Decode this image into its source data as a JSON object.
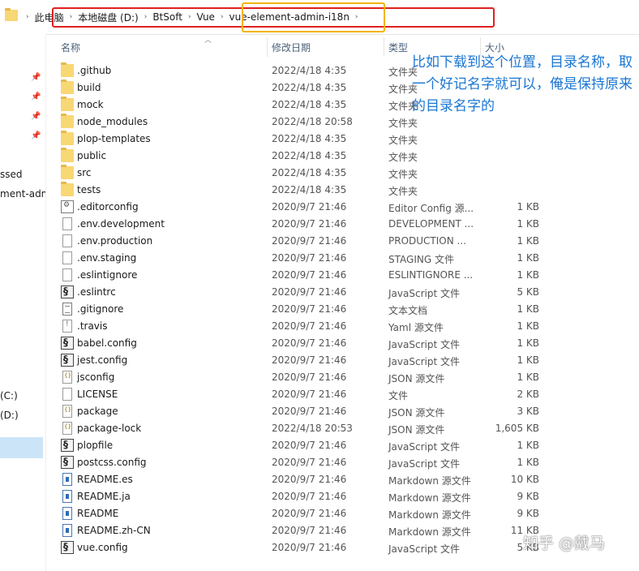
{
  "breadcrumbs": [
    "此电脑",
    "本地磁盘 (D:)",
    "BtSoft",
    "Vue",
    "vue-element-admin-i18n"
  ],
  "columns": {
    "name": "名称",
    "date": "修改日期",
    "type": "类型",
    "size": "大小"
  },
  "nav": {
    "items": [
      "ssed",
      "ment-adm",
      "(C:)",
      "(D:)"
    ]
  },
  "annotation": "比如下载到这个位置，目录名称，取一个好记名字就可以，俺是保持原来的目录名字的",
  "watermark": "知乎 @戴马",
  "files": [
    {
      "name": ".github",
      "date": "2022/4/18 4:35",
      "type": "文件夹",
      "size": "",
      "icon": "folder-icon"
    },
    {
      "name": "build",
      "date": "2022/4/18 4:35",
      "type": "文件夹",
      "size": "",
      "icon": "folder-icon"
    },
    {
      "name": "mock",
      "date": "2022/4/18 4:35",
      "type": "文件夹",
      "size": "",
      "icon": "folder-icon"
    },
    {
      "name": "node_modules",
      "date": "2022/4/18 20:58",
      "type": "文件夹",
      "size": "",
      "icon": "folder-icon"
    },
    {
      "name": "plop-templates",
      "date": "2022/4/18 4:35",
      "type": "文件夹",
      "size": "",
      "icon": "folder-icon"
    },
    {
      "name": "public",
      "date": "2022/4/18 4:35",
      "type": "文件夹",
      "size": "",
      "icon": "folder-icon"
    },
    {
      "name": "src",
      "date": "2022/4/18 4:35",
      "type": "文件夹",
      "size": "",
      "icon": "folder-icon"
    },
    {
      "name": "tests",
      "date": "2022/4/18 4:35",
      "type": "文件夹",
      "size": "",
      "icon": "folder-icon"
    },
    {
      "name": ".editorconfig",
      "date": "2020/9/7 21:46",
      "type": "Editor Config 源...",
      "size": "1 KB",
      "icon": "config-file-icon"
    },
    {
      "name": ".env.development",
      "date": "2020/9/7 21:46",
      "type": "DEVELOPMENT ...",
      "size": "1 KB",
      "icon": "file-icon"
    },
    {
      "name": ".env.production",
      "date": "2020/9/7 21:46",
      "type": "PRODUCTION ...",
      "size": "1 KB",
      "icon": "file-icon"
    },
    {
      "name": ".env.staging",
      "date": "2020/9/7 21:46",
      "type": "STAGING 文件",
      "size": "1 KB",
      "icon": "file-icon"
    },
    {
      "name": ".eslintignore",
      "date": "2020/9/7 21:46",
      "type": "ESLINTIGNORE ...",
      "size": "1 KB",
      "icon": "file-icon"
    },
    {
      "name": ".eslintrc",
      "date": "2020/9/7 21:46",
      "type": "JavaScript 文件",
      "size": "5 KB",
      "icon": "js-file-icon"
    },
    {
      "name": ".gitignore",
      "date": "2020/9/7 21:46",
      "type": "文本文档",
      "size": "1 KB",
      "icon": "text-file-icon"
    },
    {
      "name": ".travis",
      "date": "2020/9/7 21:46",
      "type": "Yaml 源文件",
      "size": "1 KB",
      "icon": "yaml-file-icon"
    },
    {
      "name": "babel.config",
      "date": "2020/9/7 21:46",
      "type": "JavaScript 文件",
      "size": "1 KB",
      "icon": "js-file-icon"
    },
    {
      "name": "jest.config",
      "date": "2020/9/7 21:46",
      "type": "JavaScript 文件",
      "size": "1 KB",
      "icon": "js-file-icon"
    },
    {
      "name": "jsconfig",
      "date": "2020/9/7 21:46",
      "type": "JSON 源文件",
      "size": "1 KB",
      "icon": "json-file-icon"
    },
    {
      "name": "LICENSE",
      "date": "2020/9/7 21:46",
      "type": "文件",
      "size": "2 KB",
      "icon": "file-icon"
    },
    {
      "name": "package",
      "date": "2020/9/7 21:46",
      "type": "JSON 源文件",
      "size": "3 KB",
      "icon": "json-file-icon"
    },
    {
      "name": "package-lock",
      "date": "2022/4/18 20:53",
      "type": "JSON 源文件",
      "size": "1,605 KB",
      "icon": "json-file-icon"
    },
    {
      "name": "plopfile",
      "date": "2020/9/7 21:46",
      "type": "JavaScript 文件",
      "size": "1 KB",
      "icon": "js-file-icon"
    },
    {
      "name": "postcss.config",
      "date": "2020/9/7 21:46",
      "type": "JavaScript 文件",
      "size": "1 KB",
      "icon": "js-file-icon"
    },
    {
      "name": "README.es",
      "date": "2020/9/7 21:46",
      "type": "Markdown 源文件",
      "size": "10 KB",
      "icon": "markdown-file-icon"
    },
    {
      "name": "README.ja",
      "date": "2020/9/7 21:46",
      "type": "Markdown 源文件",
      "size": "9 KB",
      "icon": "markdown-file-icon"
    },
    {
      "name": "README",
      "date": "2020/9/7 21:46",
      "type": "Markdown 源文件",
      "size": "9 KB",
      "icon": "markdown-file-icon"
    },
    {
      "name": "README.zh-CN",
      "date": "2020/9/7 21:46",
      "type": "Markdown 源文件",
      "size": "11 KB",
      "icon": "markdown-file-icon"
    },
    {
      "name": "vue.config",
      "date": "2020/9/7 21:46",
      "type": "JavaScript 文件",
      "size": "5 KB",
      "icon": "js-file-icon"
    }
  ]
}
